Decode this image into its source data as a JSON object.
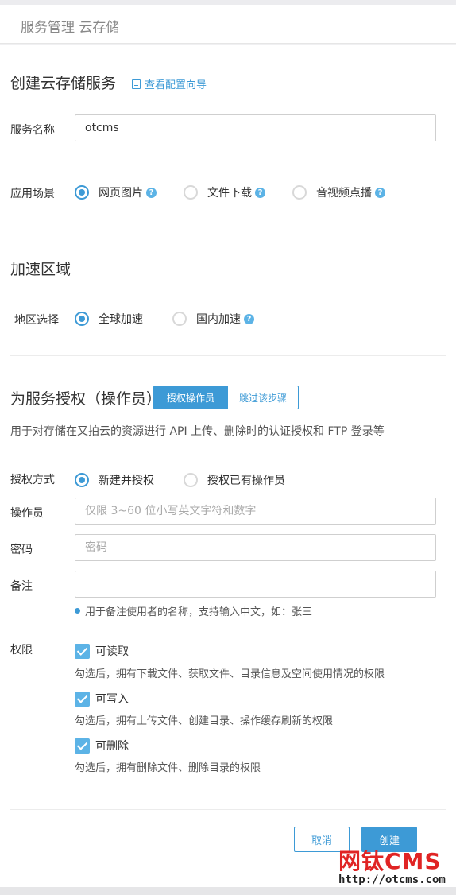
{
  "header": {
    "title": "服务管理 云存储"
  },
  "create": {
    "title": "创建云存储服务",
    "guide_link": "查看配置向导",
    "service_name_label": "服务名称",
    "service_name_value": "otcms",
    "scene_label": "应用场景",
    "scenes": [
      {
        "label": "网页图片",
        "selected": true
      },
      {
        "label": "文件下载",
        "selected": false
      },
      {
        "label": "音视频点播",
        "selected": false
      }
    ]
  },
  "accel": {
    "title": "加速区域",
    "region_label": "地区选择",
    "regions": [
      {
        "label": "全球加速",
        "selected": true
      },
      {
        "label": "国内加速",
        "selected": false
      }
    ]
  },
  "auth": {
    "title": "为服务授权（操作员）",
    "tab_active": "授权操作员",
    "tab_skip": "跳过该步骤",
    "description": "用于对存储在又拍云的资源进行 API 上传、删除时的认证授权和 FTP 登录等",
    "method_label": "授权方式",
    "methods": [
      {
        "label": "新建并授权",
        "selected": true
      },
      {
        "label": "授权已有操作员",
        "selected": false
      }
    ],
    "operator_label": "操作员",
    "operator_placeholder": "仅限 3~60 位小写英文字符和数字",
    "password_label": "密码",
    "password_placeholder": "密码",
    "remark_label": "备注",
    "remark_placeholder": "",
    "remark_hint": "用于备注使用者的名称，支持输入中文，如：张三",
    "perm_label": "权限",
    "permissions": [
      {
        "label": "可读取",
        "desc": "勾选后，拥有下载文件、获取文件、目录信息及空间使用情况的权限",
        "checked": true
      },
      {
        "label": "可写入",
        "desc": "勾选后，拥有上传文件、创建目录、操作缓存刷新的权限",
        "checked": true
      },
      {
        "label": "可删除",
        "desc": "勾选后，拥有删除文件、删除目录的权限",
        "checked": true
      }
    ]
  },
  "actions": {
    "cancel": "取消",
    "create": "创建"
  },
  "watermark": {
    "logo": "网钛CMS",
    "url": "http://otcms.com"
  },
  "colors": {
    "accent": "#3d9ad6",
    "watermark": "#e02424"
  }
}
